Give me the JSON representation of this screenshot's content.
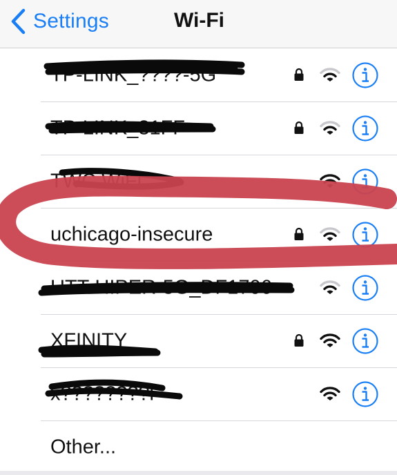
{
  "navbar": {
    "back_label": "Settings",
    "title": "Wi-Fi"
  },
  "networks": [
    {
      "name": "TP-LINK_????-5G",
      "redacted": true,
      "secured": true,
      "signal": 2
    },
    {
      "name": "TP-LINK_31FF",
      "redacted": true,
      "secured": true,
      "signal": 2
    },
    {
      "name": "TWC WiFi",
      "redacted": true,
      "secured": false,
      "signal": 3
    },
    {
      "name": "uchicago-insecure",
      "redacted": false,
      "secured": true,
      "signal": 2,
      "highlighted": true
    },
    {
      "name": "UTT-HIPER-5G_DF1706",
      "redacted": true,
      "secured": false,
      "signal": 2
    },
    {
      "name": "XFINITY",
      "redacted": true,
      "secured": true,
      "signal": 3
    },
    {
      "name": "x????????l",
      "redacted": true,
      "secured": false,
      "signal": 3
    }
  ],
  "other_label": "Other...",
  "colors": {
    "accent": "#1a7ff5",
    "highlight_marker": "#c9434f",
    "redaction": "#0a0a0a"
  },
  "icons": {
    "back": "chevron-left-icon",
    "lock": "lock-icon",
    "wifi": "wifi-icon",
    "info": "info-circle-icon"
  }
}
